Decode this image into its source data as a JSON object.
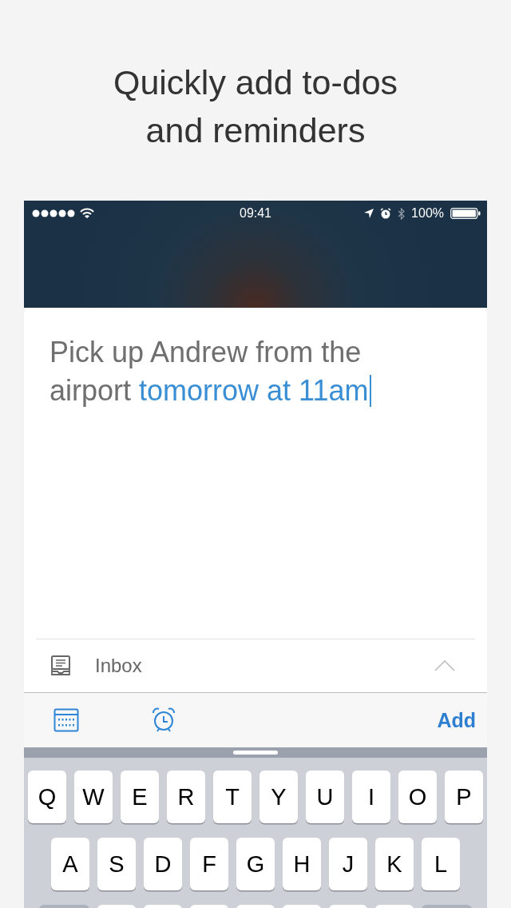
{
  "headline": [
    "Quickly add to-dos",
    "and reminders"
  ],
  "status_bar": {
    "time": "09:41",
    "battery": "100%"
  },
  "task": {
    "text": "Pick up Andrew from the airport",
    "date_phrase": "tomorrow at 11am"
  },
  "list": {
    "name": "Inbox"
  },
  "toolbar": {
    "add_button": "Add"
  },
  "keyboard": {
    "rows": [
      [
        "Q",
        "W",
        "E",
        "R",
        "T",
        "Y",
        "U",
        "I",
        "O",
        "P"
      ],
      [
        "A",
        "S",
        "D",
        "F",
        "G",
        "H",
        "J",
        "K",
        "L"
      ]
    ]
  }
}
